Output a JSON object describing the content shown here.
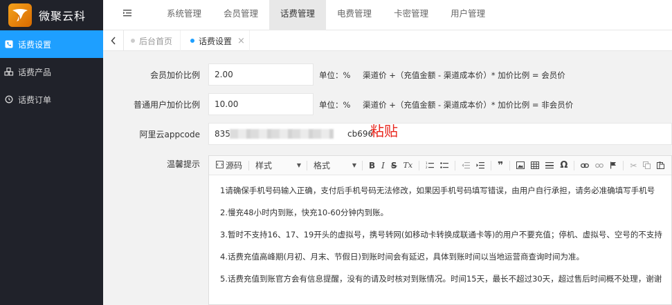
{
  "app": {
    "title": "微聚云科"
  },
  "top_nav": [
    {
      "label": "系统管理",
      "active": false
    },
    {
      "label": "会员管理",
      "active": false
    },
    {
      "label": "话费管理",
      "active": true
    },
    {
      "label": "电费管理",
      "active": false
    },
    {
      "label": "卡密管理",
      "active": false
    },
    {
      "label": "用户管理",
      "active": false
    }
  ],
  "sidebar": {
    "items": [
      {
        "label": "话费设置",
        "icon": "phone-icon",
        "active": true
      },
      {
        "label": "话费产品",
        "icon": "cubes-icon",
        "active": false
      },
      {
        "label": "话费订单",
        "icon": "clock-icon",
        "active": false
      }
    ]
  },
  "tabs": [
    {
      "label": "后台首页",
      "active": false
    },
    {
      "label": "话费设置",
      "active": true,
      "close": "×"
    }
  ],
  "form": {
    "member_markup": {
      "label": "会员加价比例",
      "value": "2.00",
      "unit": "单位：%",
      "formula": "渠道价 +（充值金额 - 渠道成本价）* 加价比例 = 会员价"
    },
    "normal_markup": {
      "label": "普通用户加价比例",
      "value": "10.00",
      "unit": "单位：%",
      "formula": "渠道价 +（充值金额 - 渠道成本价）* 加价比例 = 非会员价"
    },
    "appcode": {
      "label": "阿里云appcode",
      "value_prefix": "835",
      "value_suffix": "cb696",
      "note": "粘贴"
    },
    "tips": {
      "label": "温馨提示"
    }
  },
  "editor": {
    "toolbar": {
      "source": "源码",
      "style": "样式",
      "format": "格式",
      "bold": "B",
      "italic": "I",
      "strike": "S",
      "clear": "Tx",
      "quote": "❞",
      "omega": "Ω"
    },
    "lines": [
      "1请确保手机号码输入正确，支付后手机号码无法修改，如果因手机号码填写错误，由用户自行承担，请务必准确填写手机号",
      "2.慢充48小时内到账，快充10-60分钟内到账。",
      "3.暂时不支持16、17、19开头的虚拟号，携号转网(如移动卡转换成联通卡等)的用户不要充值；停机、虚拟号、空号的不支持",
      "4.话费充值高峰期(月初、月末、节假日)到账时间会有延迟，具体到账时间以当地运营商查询时间为准。",
      "5.话费充值到账官方会有信息提醒，没有的请及时核对到账情况。时间15天，最长不超过30天，超过售后时间概不处理，谢谢"
    ]
  }
}
